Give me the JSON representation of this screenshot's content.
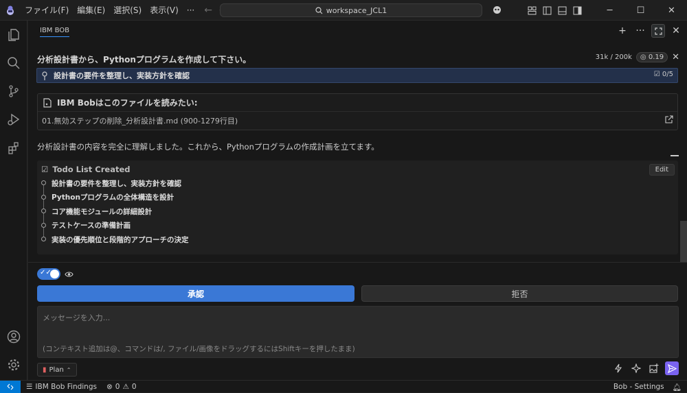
{
  "titlebar": {
    "menus": [
      "ファイル(F)",
      "編集(E)",
      "選択(S)",
      "表示(V)",
      "···"
    ],
    "search_text": "workspace_JCL1"
  },
  "panel": {
    "tab_label": "IBM BOB"
  },
  "task": {
    "title": "分析設計書から、Pythonプログラムを作成して下さい。",
    "tokens": "31k / 200k",
    "cost": "0.19",
    "current_step": "設計書の要件を整理し、実装方針を確認",
    "step_count": "0/5"
  },
  "file_card": {
    "heading": "IBM Bobはこのファイルを読みたい:",
    "path": "01.無効ステップの削除_分析設計書.md  (900-1279行目)"
  },
  "message": "分析設計書の内容を完全に理解しました。これから、Pythonプログラムの作成計画を立てます。",
  "todo": {
    "heading": "Todo List Created",
    "edit_label": "Edit",
    "items": [
      "設計書の要件を整理し、実装方針を確認",
      "Pythonプログラムの全体構造を設計",
      "コア機能モジュールの詳細設計",
      "テストケースの準備計画",
      "実装の優先順位と段階的アプローチの決定"
    ]
  },
  "composer": {
    "approve_label": "承認",
    "reject_label": "拒否",
    "placeholder": "メッセージを入力...",
    "hint": "(コンテキスト追加は@、コマンドは/, ファイル/画像をドラッグするにはShiftキーを押したまま)",
    "mode_label": "Plan"
  },
  "statusbar": {
    "findings_label": "IBM Bob Findings",
    "errors": "0",
    "warnings": "0",
    "right_label": "Bob - Settings"
  },
  "colors": {
    "accent": "#3a78d6",
    "send": "#7a63f0",
    "remote": "#0078d4"
  }
}
